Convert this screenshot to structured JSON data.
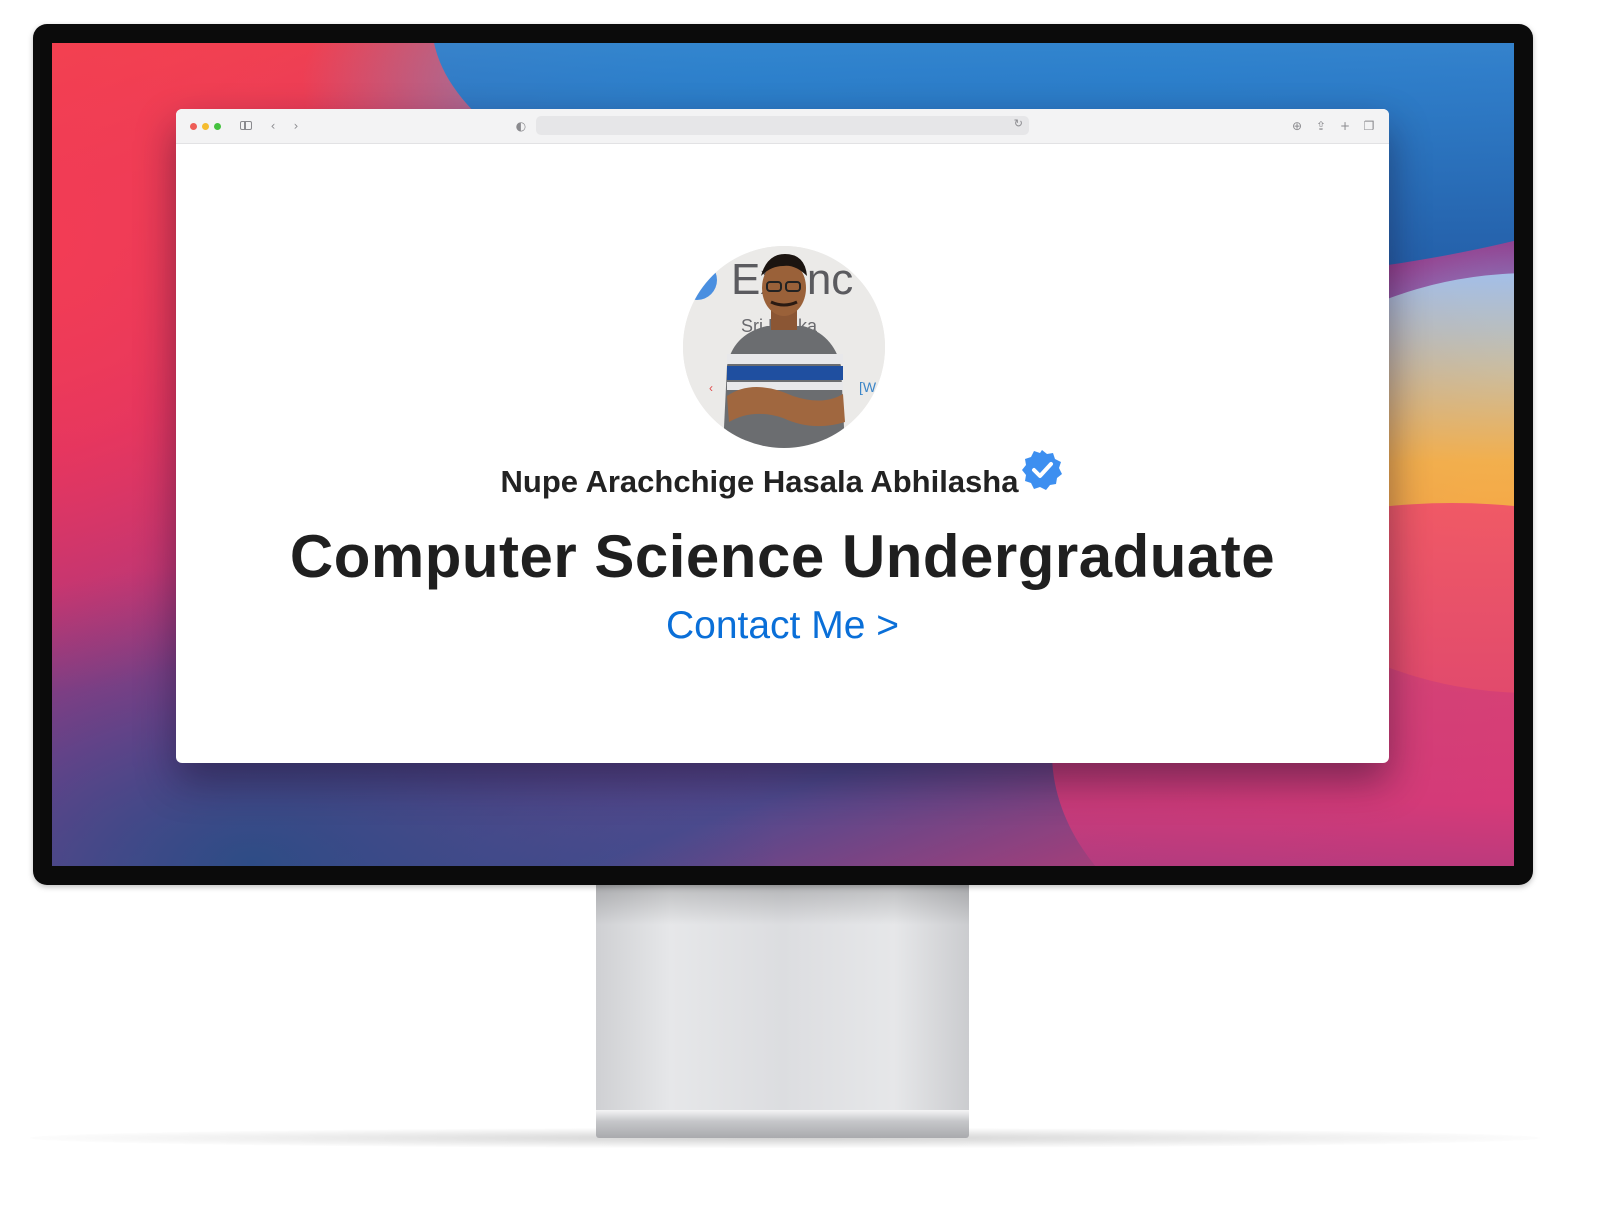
{
  "profile": {
    "name": "Nupe Arachchige Hasala Abhilasha",
    "headline": "Computer Science Undergraduate",
    "contact_link": "Contact Me >",
    "photo_backdrop_text": "Exenc",
    "photo_backdrop_subtext": "Sri Lanka",
    "verified_badge_icon": "verified-badge-icon"
  },
  "colors": {
    "link": "#0a6fd8",
    "verified_badge": "#3d8ff0",
    "text": "#222222"
  },
  "browser": {
    "icons": [
      "sidebar-icon",
      "back-icon",
      "forward-icon",
      "shield-icon",
      "reload-icon",
      "download-icon",
      "share-icon",
      "new-tab-icon",
      "tabs-overview-icon"
    ]
  }
}
